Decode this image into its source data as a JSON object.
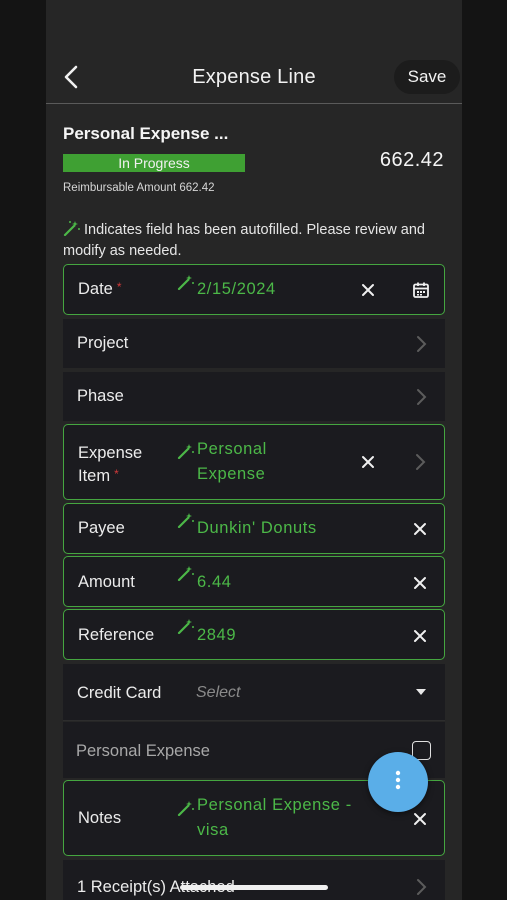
{
  "header": {
    "title": "Expense Line",
    "save_label": "Save"
  },
  "summary": {
    "title": "Personal Expense ...",
    "status": "In Progress",
    "amount": "662.42",
    "reimbursable": "Reimbursable Amount 662.42"
  },
  "notice": "Indicates field has been autofilled. Please review and modify as needed.",
  "fields": {
    "date": {
      "label": "Date",
      "value": "2/15/2024"
    },
    "project": {
      "label": "Project"
    },
    "phase": {
      "label": "Phase"
    },
    "expense_item": {
      "label_line1": "Expense",
      "label_line2": "Item",
      "value_line1": "Personal",
      "value_line2": "Expense"
    },
    "payee": {
      "label": "Payee",
      "value": "Dunkin' Donuts"
    },
    "amount": {
      "label": "Amount",
      "value": "6.44"
    },
    "reference": {
      "label": "Reference",
      "value": "2849"
    },
    "credit_card": {
      "label": "Credit Card",
      "placeholder": "Select"
    },
    "personal_expense": {
      "label": "Personal Expense"
    },
    "notes": {
      "label": "Notes",
      "value_line1": "Personal Expense -",
      "value_line2": "visa"
    },
    "receipts": {
      "label": "1 Receipt(s) Attached"
    }
  },
  "colors": {
    "accent_green": "#45a640",
    "status_green": "#3fa033",
    "fab_blue": "#5aaee8",
    "required_red": "#d23a3a"
  },
  "icons": [
    "back-arrow-icon",
    "magic-wand-icon",
    "calendar-icon",
    "close-icon",
    "chevron-right-icon",
    "dropdown-caret-icon",
    "more-vertical-icon"
  ]
}
